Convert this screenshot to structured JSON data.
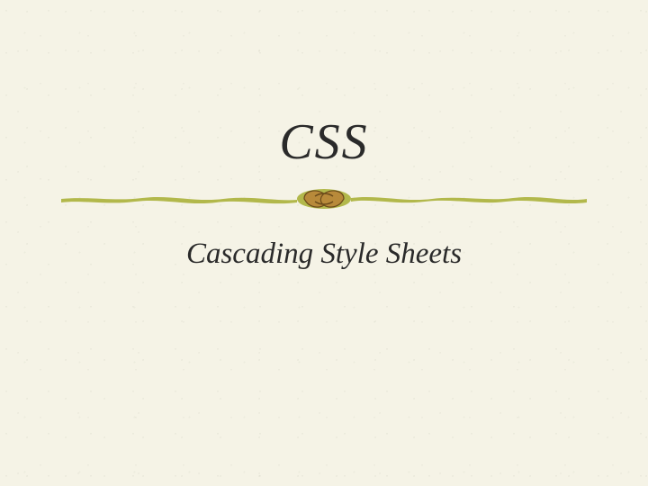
{
  "slide": {
    "title": "CSS",
    "subtitle": "Cascading Style Sheets",
    "divider": {
      "line_color": "#b2b84b",
      "knot_fill": "#b88a3a",
      "knot_outline": "#6a4a1a"
    },
    "background": "#f5f3e6"
  }
}
